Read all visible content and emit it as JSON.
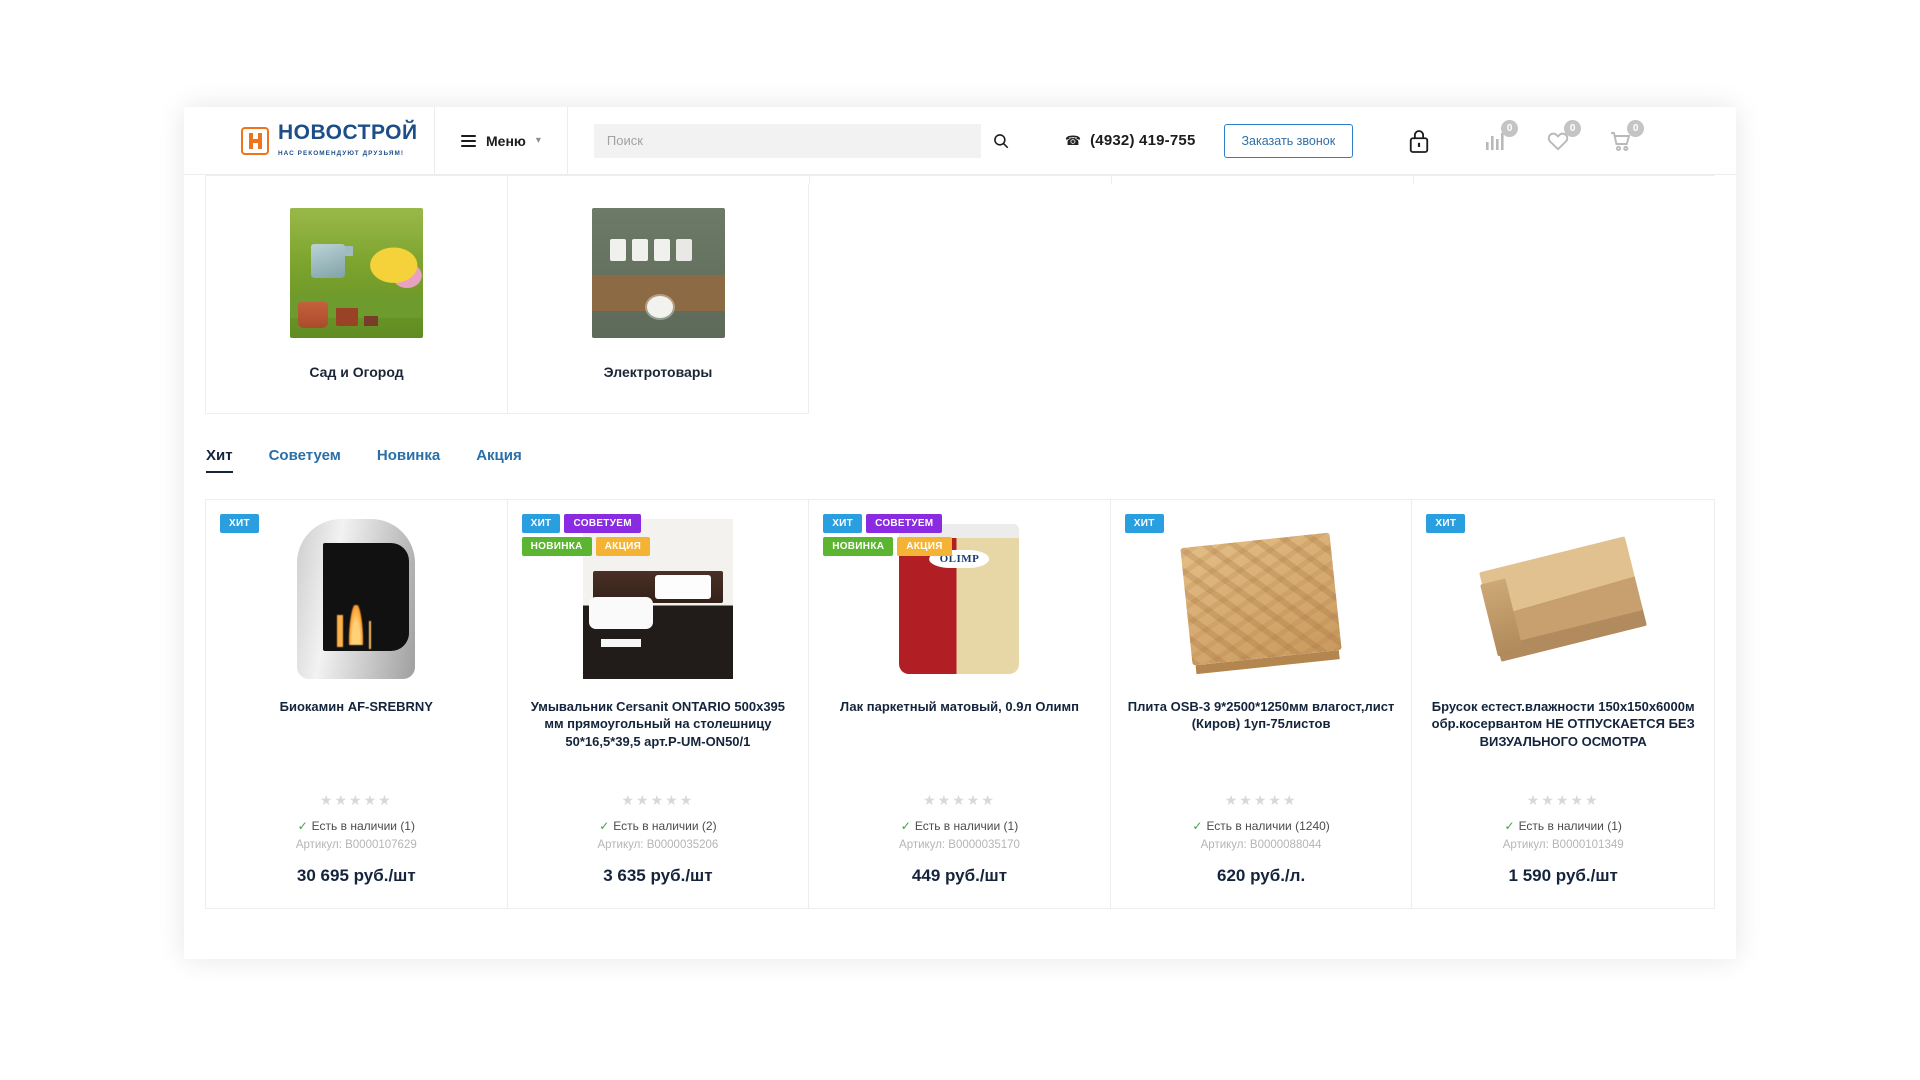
{
  "header": {
    "logo_name": "НОВОСТРОЙ",
    "logo_tagline": "НАС РЕКОМЕНДУЮТ ДРУЗЬЯМ!",
    "menu_label": "Меню",
    "menu_chevron": "chevron-down-icon",
    "search_placeholder": "Поиск",
    "search_value": "",
    "phone": "(4932) 419-755",
    "callback_label": "Заказать звонок",
    "icons": {
      "lock": "lock-icon",
      "compare": "compare-icon",
      "wishlist": "heart-icon",
      "cart": "cart-icon"
    },
    "compare_count": "0",
    "wishlist_count": "0",
    "cart_count": "0"
  },
  "categories": [
    {
      "name": "Сад и Огород",
      "image": "garden-tools-image"
    },
    {
      "name": "Электротовары",
      "image": "electrical-sockets-image"
    }
  ],
  "tabs": [
    {
      "label": "Хит",
      "active": true
    },
    {
      "label": "Советуем",
      "active": false
    },
    {
      "label": "Новинка",
      "active": false
    },
    {
      "label": "Акция",
      "active": false
    }
  ],
  "products": [
    {
      "title": "Биокамин AF-SREBRNY",
      "badges": [
        {
          "label": "ХИТ",
          "color": "#2a9fe0"
        }
      ],
      "rating": 0,
      "availability": "Есть в наличии (1)",
      "sku": "Артикул: B0000107629",
      "price": "30 695 руб./шт",
      "image": "biofireplace-image"
    },
    {
      "title": "Умывальник Cersanit ONTARIO 500х395 мм прямоугольный на столешницу 50*16,5*39,5 арт.P-UM-ON50/1",
      "badges": [
        {
          "label": "ХИТ",
          "color": "#2a9fe0"
        },
        {
          "label": "СОВЕТУЕМ",
          "color": "#8a2be2"
        },
        {
          "label": "НОВИНКА",
          "color": "#5cb531"
        },
        {
          "label": "АКЦИЯ",
          "color": "#f5b335"
        }
      ],
      "rating": 0,
      "availability": "Есть в наличии (2)",
      "sku": "Артикул: B0000035206",
      "price": "3 635 руб./шт",
      "image": "washbasin-image"
    },
    {
      "title": "Лак паркетный матовый, 0.9л Олимп",
      "badges": [
        {
          "label": "ХИТ",
          "color": "#2a9fe0"
        },
        {
          "label": "СОВЕТУЕМ",
          "color": "#8a2be2"
        },
        {
          "label": "НОВИНКА",
          "color": "#5cb531"
        },
        {
          "label": "АКЦИЯ",
          "color": "#f5b335"
        }
      ],
      "rating": 0,
      "availability": "Есть в наличии (1)",
      "sku": "Артикул: B0000035170",
      "price": "449 руб./шт",
      "image": "lacquer-can-image"
    },
    {
      "title": "Плита OSB-3 9*2500*1250мм влагост,лист (Киров) 1уп-75листов",
      "badges": [
        {
          "label": "ХИТ",
          "color": "#2a9fe0"
        }
      ],
      "rating": 0,
      "availability": "Есть в наличии (1240)",
      "sku": "Артикул: B0000088044",
      "price": "620 руб./л.",
      "image": "osb-board-image"
    },
    {
      "title": "Брусок естест.влажности 150х150х6000м обр.косервантом НЕ ОТПУСКАЕТСЯ БЕЗ ВИЗУАЛЬНОГО ОСМОТРА",
      "badges": [
        {
          "label": "ХИТ",
          "color": "#2a9fe0"
        }
      ],
      "rating": 0,
      "availability": "Есть в наличии (1)",
      "sku": "Артикул: B0000101349",
      "price": "1 590 руб./шт",
      "image": "timber-beam-image"
    }
  ],
  "colors": {
    "brand_blue": "#1d4e89",
    "brand_orange": "#f1721c",
    "link_blue": "#2a6fa8",
    "in_stock_green": "#43a047"
  }
}
